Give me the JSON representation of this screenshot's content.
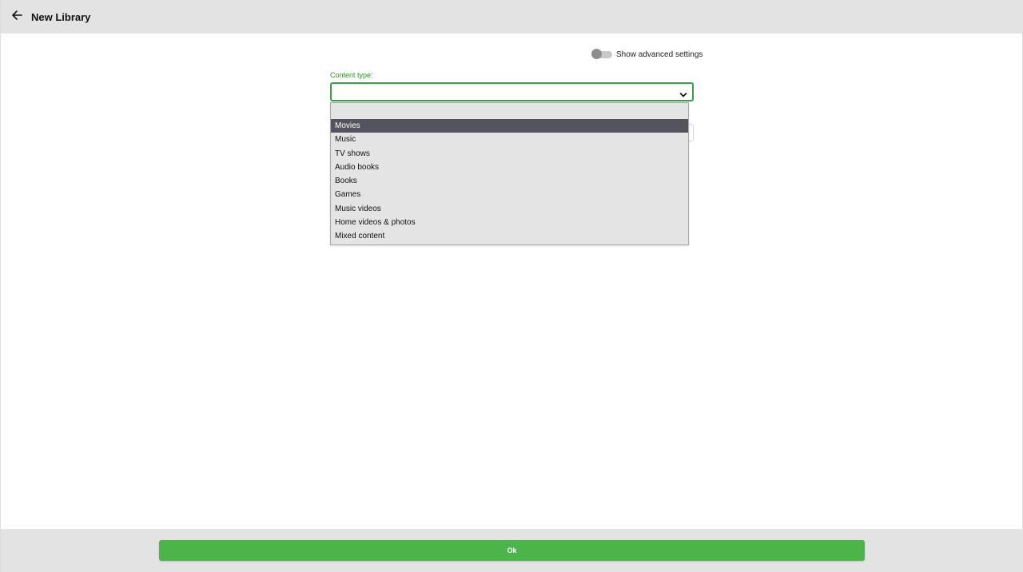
{
  "header": {
    "title": "New Library",
    "back_icon": "arrow-left-icon"
  },
  "advanced_toggle": {
    "label": "Show advanced settings",
    "enabled": false
  },
  "content_type": {
    "label": "Content type:",
    "selected_value": "",
    "chevron_icon": "chevron-down-icon",
    "accent_color": "#37a14a"
  },
  "dropdown": {
    "highlighted_index": 0,
    "options": [
      "Movies",
      "Music",
      "TV shows",
      "Audio books",
      "Books",
      "Games",
      "Music videos",
      "Home videos & photos",
      "Mixed content"
    ]
  },
  "footer": {
    "ok_label": "Ok",
    "ok_color": "#4cb54a"
  }
}
